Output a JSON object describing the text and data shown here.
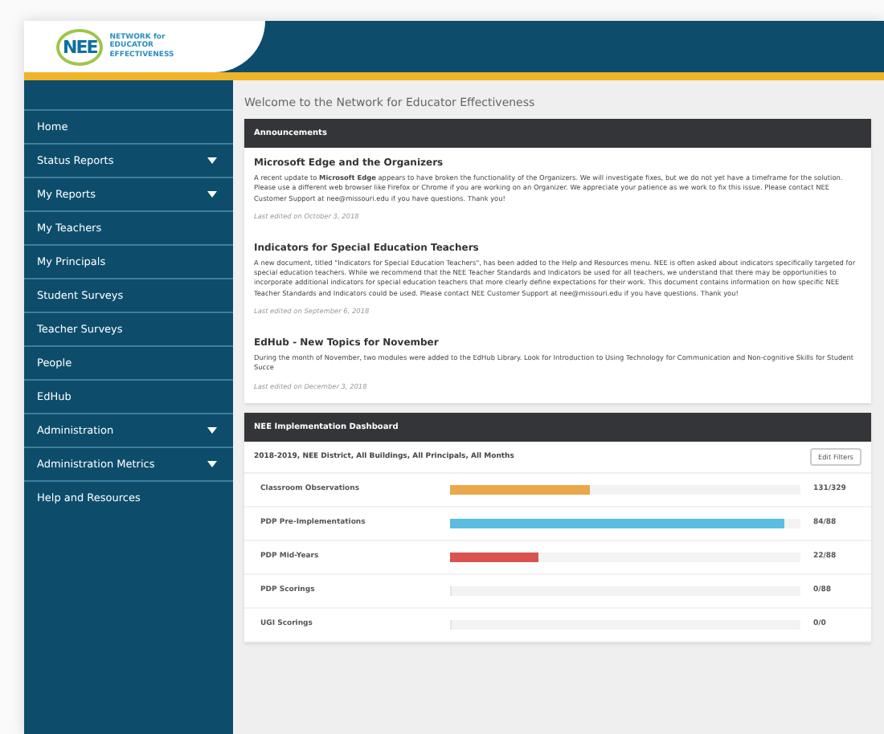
{
  "header": {
    "logo_mark": "NEE",
    "logo_lines": [
      "NETWORK for",
      "EDUCATOR",
      "EFFECTIVENESS"
    ]
  },
  "sidebar": {
    "items": [
      {
        "label": "Home",
        "expandable": false
      },
      {
        "label": "Status Reports",
        "expandable": true
      },
      {
        "label": "My Reports",
        "expandable": true
      },
      {
        "label": "My Teachers",
        "expandable": false
      },
      {
        "label": "My Principals",
        "expandable": false
      },
      {
        "label": "Student Surveys",
        "expandable": false
      },
      {
        "label": "Teacher Surveys",
        "expandable": false
      },
      {
        "label": "People",
        "expandable": false
      },
      {
        "label": "EdHub",
        "expandable": false
      },
      {
        "label": "Administration",
        "expandable": true
      },
      {
        "label": "Administration Metrics",
        "expandable": true
      },
      {
        "label": "Help and Resources",
        "expandable": false
      }
    ]
  },
  "welcome": "Welcome to the Network for Educator Effectiveness",
  "announcements": {
    "title": "Announcements",
    "items": [
      {
        "title": "Microsoft Edge and the Organizers",
        "body": "A recent update to **Microsoft Edge** appears to have broken the functionality of the Organizers.  We will investigate fixes, but we do not yet have a timeframe for the solution.  Please use a different web browser like Firefox or Chrome if you are working on an Organizer.  We appreciate your patience as we work to fix this issue.  Please contact NEE Customer Support at nee@missouri.edu if you have questions.  Thank you!",
        "edited": "Last edited on October 3, 2018"
      },
      {
        "title": "Indicators for Special Education Teachers",
        "body": "A new document, titled \"Indicators for Special Education Teachers\", has been added to the Help and Resources menu.  NEE is often asked about indicators specifically targeted for special education teachers.  While we recommend that the NEE Teacher Standards and Indicators be used for all teachers, we understand that there may be opportunities to incorporate additional indicators for special education teachers that more clearly define expectations for their work.  This document contains information on how specific NEE Teacher Standards and Indicators could be used.  Please contact NEE Customer Support at nee@missouri.edu if you have questions.  Thank you!",
        "edited": "Last edited on September 6, 2018"
      },
      {
        "title": "EdHub - New Topics for November",
        "body": "During the month of November, two modules were added to the EdHub Library. Look for Introduction to Using Technology for Communication and Non-cognitive Skills for Student Succe",
        "edited": "Last edited on December 3, 2018"
      }
    ]
  },
  "dashboard": {
    "title": "NEE Implementation Dashboard",
    "filter": "2018-2019, NEE District, All Buildings, All Principals, All Months",
    "filter_button": "Edit Filters",
    "rows": [
      {
        "label": "Classroom Observations",
        "level": 0.4,
        "color": "#eaa84b",
        "reading": "131/329"
      },
      {
        "label": "PDP Pre-Implementations",
        "level": 0.955,
        "color": "#5bbde0",
        "reading": "84/88"
      },
      {
        "label": "PDP Mid-Years",
        "level": 0.25,
        "color": "#d9534f",
        "reading": "22/88"
      },
      {
        "label": "PDP Scorings",
        "level": 0,
        "reading": "0/88"
      },
      {
        "label": "UGI Scorings",
        "level": 0,
        "reading": "0/0"
      }
    ]
  }
}
